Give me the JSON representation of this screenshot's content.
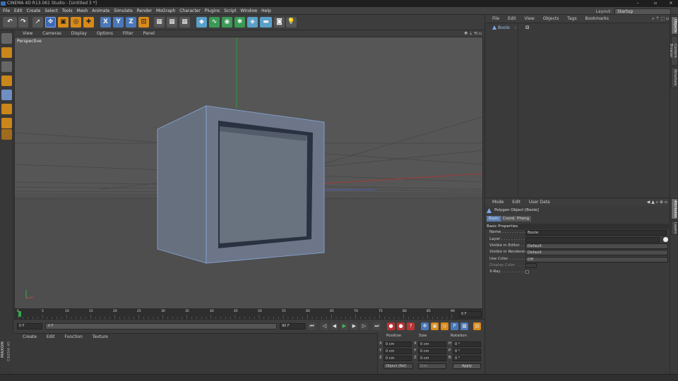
{
  "window": {
    "title": "CINEMA 4D R13.061 Studio - [Untitled 3 *]",
    "controls": [
      "–",
      "▫",
      "×"
    ]
  },
  "menubar": {
    "items": [
      "File",
      "Edit",
      "Create",
      "Select",
      "Tools",
      "Mesh",
      "Animate",
      "Simulate",
      "Render",
      "MoGraph",
      "Character",
      "Plugins",
      "Script",
      "Window",
      "Help"
    ],
    "layout_label": "Layout:",
    "layout_value": "Startup"
  },
  "toolbar": {
    "axis_x": "X",
    "axis_y": "Y",
    "axis_z": "Z"
  },
  "viewport": {
    "menu": [
      "View",
      "Cameras",
      "Display",
      "Options",
      "Filter",
      "Panel"
    ],
    "label": "Perspective",
    "nav_icons": "✥ ⇣ ⟲ ▫"
  },
  "timeline": {
    "ticks": [
      "0",
      "5",
      "10",
      "15",
      "20",
      "25",
      "30",
      "35",
      "40",
      "45",
      "50",
      "55",
      "60",
      "65",
      "70",
      "75",
      "80",
      "85",
      "90"
    ],
    "end_label": "0 F",
    "start_field": "0 F",
    "range_start": "0 F",
    "range_end": "90 F",
    "end_field": "90 F"
  },
  "material_manager": {
    "menu": [
      "Create",
      "Edit",
      "Function",
      "Texture"
    ]
  },
  "coordinates": {
    "headers": [
      "Position",
      "Size",
      "Rotation"
    ],
    "rows": [
      {
        "axis": "X",
        "pos": "0 cm",
        "size_axis": "X",
        "size": "0 cm",
        "rot_axis": "H",
        "rot": "0 °"
      },
      {
        "axis": "Y",
        "pos": "0 cm",
        "size_axis": "Y",
        "size": "0 cm",
        "rot_axis": "P",
        "rot": "0 °"
      },
      {
        "axis": "Z",
        "pos": "0 cm",
        "size_axis": "Z",
        "size": "0 cm",
        "rot_axis": "B",
        "rot": "0 °"
      }
    ],
    "mode": "Object (Rel)",
    "size_mode": "Size",
    "apply": "Apply"
  },
  "object_manager": {
    "menu": [
      "File",
      "Edit",
      "View",
      "Objects",
      "Tags",
      "Bookmarks"
    ],
    "objects": [
      {
        "name": "Boole"
      }
    ]
  },
  "attributes": {
    "menu": [
      "Mode",
      "Edit",
      "User Data"
    ],
    "object_title": "Polygon Object [Boole]",
    "tabs": [
      "Basic",
      "Coord.",
      "Phong"
    ],
    "section": "Basic Properties",
    "fields": [
      {
        "label": "Name . . . . . . . . . . .",
        "value": "Boole"
      },
      {
        "label": "Layer . . . . . . . . . . .",
        "value": ""
      },
      {
        "label": "Visible in Editor . . .",
        "value": "Default"
      },
      {
        "label": "Visible in Renderer",
        "value": "Default"
      },
      {
        "label": "Use Color . . . . . . . .",
        "value": "Off"
      },
      {
        "label": "Display Color . . . . .",
        "value": ""
      },
      {
        "label": "X-Ray . . . . . . . . . .",
        "value": ""
      }
    ]
  },
  "right_tabs": [
    "Objects",
    "Content Browser",
    "Structure",
    "Attributes",
    "Layers"
  ],
  "brand": {
    "maxon": "MAXON",
    "product": "CINEMA 4D"
  }
}
